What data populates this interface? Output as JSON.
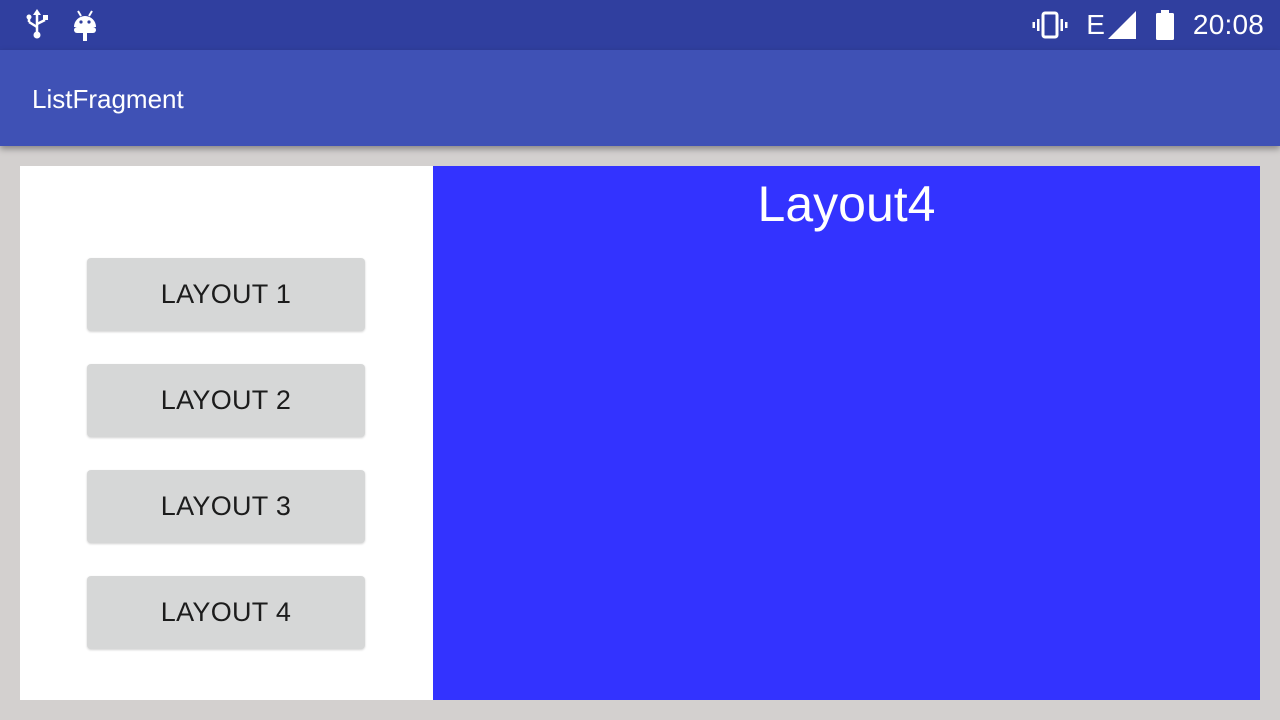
{
  "status_bar": {
    "left_icons": [
      "usb-icon",
      "android-debug-icon"
    ],
    "right_icons": [
      "vibrate-icon",
      "network-edge-signal-icon",
      "battery-icon"
    ],
    "network_label": "E",
    "time": "20:08"
  },
  "app_bar": {
    "title": "ListFragment"
  },
  "list": {
    "buttons": [
      {
        "label": "LAYOUT 1"
      },
      {
        "label": "LAYOUT 2"
      },
      {
        "label": "LAYOUT 3"
      },
      {
        "label": "LAYOUT 4"
      }
    ]
  },
  "detail": {
    "title": "Layout4"
  },
  "colors": {
    "status_bar": "#303f9f",
    "app_bar": "#3f51b5",
    "detail_background": "#3333ff",
    "button_background": "#d6d7d7",
    "window_background": "#d3d0cf"
  }
}
